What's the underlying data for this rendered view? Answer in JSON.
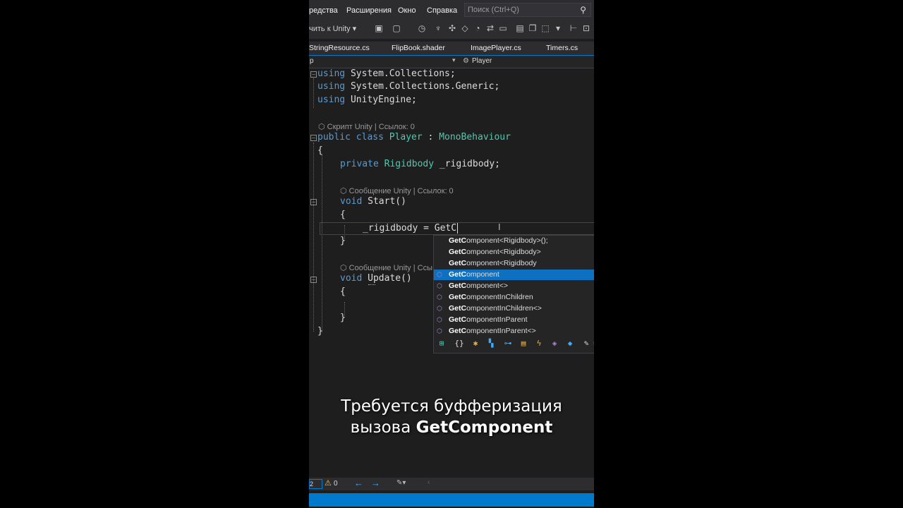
{
  "menu": {
    "items": [
      "редства",
      "Расширения",
      "Окно",
      "Справка"
    ],
    "search_placeholder": "Поиск (Ctrl+Q)"
  },
  "toolbar": {
    "attach_label": "чить к Unity ▾"
  },
  "tabs": [
    "StringResource.cs",
    "FlipBook.shader",
    "ImagePlayer.cs",
    "Timers.cs"
  ],
  "navbar": {
    "left": "p",
    "right": "Player"
  },
  "code": {
    "using1_kw": "using",
    "using1_ns": " System.Collections;",
    "using2_kw": "using",
    "using2_ns": " System.Collections.Generic;",
    "using3_kw": "using",
    "using3_ns": " UnityEngine;",
    "lens_class": "Скрипт Unity | Ссылок: 0",
    "class_kw": "public class",
    "class_name": "Player",
    "class_colon": " : ",
    "class_base": "MonoBehaviour",
    "brace_open": "{",
    "field_kw": "private",
    "field_type": "Rigidbody",
    "field_name": " _rigidbody;",
    "lens_start": "Сообщение Unity | Ссылок: 0",
    "start_kw": "void",
    "start_name": " Start()",
    "start_brace_open": "{",
    "assign_line": "_rigidbody = GetC",
    "start_brace_close": "}",
    "lens_update": "Сообщение Unity | Ссы",
    "update_kw": "void",
    "update_name": " Update()",
    "update_brace_open": "{",
    "update_brace_close": "}",
    "brace_close": "}"
  },
  "autocomplete": {
    "items": [
      {
        "bold": "GetC",
        "rest": "omponent<Rigidbody>();",
        "icon": ""
      },
      {
        "bold": "GetC",
        "rest": "omponent<Rigidbody>",
        "icon": ""
      },
      {
        "bold": "GetC",
        "rest": "omponent<Rigidbody",
        "icon": ""
      },
      {
        "bold": "GetC",
        "rest": "omponent",
        "icon": "method-icon"
      },
      {
        "bold": "GetC",
        "rest": "omponent<>",
        "icon": "method-icon"
      },
      {
        "bold": "GetC",
        "rest": "omponentInChildren",
        "icon": "method-icon"
      },
      {
        "bold": "GetC",
        "rest": "omponentInChildren<>",
        "icon": "method-icon"
      },
      {
        "bold": "GetC",
        "rest": "omponentInParent",
        "icon": "method-icon"
      },
      {
        "bold": "GetC",
        "rest": "omponentInParent<>",
        "icon": "method-icon"
      }
    ],
    "selected_index": 3,
    "filter_icons": [
      "snippet-icon",
      "namespace-icon",
      "class-icon",
      "struct-icon",
      "delegate-icon",
      "interface-icon",
      "enum-icon",
      "event-icon",
      "extension-icon",
      "wrench-icon",
      "method-icon"
    ]
  },
  "caption": {
    "line1": "Требуется буфферизация",
    "line2_prefix": "вызова ",
    "line2_bold": "GetComponent"
  },
  "status": {
    "errors": "2",
    "warnings": "0"
  },
  "colors": {
    "accent": "#007acc",
    "selection": "#0e70c0",
    "keyword": "#569cd6",
    "type": "#4ec9b0"
  }
}
